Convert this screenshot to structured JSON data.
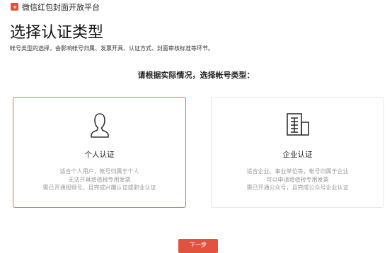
{
  "header": {
    "app_title": "微信红包封面开放平台",
    "logo_icon": "red-envelope-icon"
  },
  "page": {
    "title": "选择认证类型",
    "subtitle": "帐号类型的选择，会影响帐号归属、发票开具、认证方式、封面审核标准等环节。",
    "prompt": "请根据实际情况，选择帐号类型："
  },
  "cards": [
    {
      "id": "personal",
      "icon": "person-icon",
      "title": "个人认证",
      "desc": [
        "适合个人用户，帐号归属于个人",
        "无法开具增值税专用发票",
        "需已开通视频号，且完成兴趣认证或职业认证"
      ],
      "selected": true,
      "accent": "#e06a58"
    },
    {
      "id": "enterprise",
      "icon": "building-icon",
      "title": "企业认证",
      "desc": [
        "适合企业、事业单位等，帐号归属于企业",
        "可以申请增值税专用发票",
        "需已开通公众号，且完成公众号企业认证"
      ],
      "selected": false
    }
  ],
  "footer": {
    "next_label": "下一步"
  },
  "colors": {
    "primary": "#e2533f",
    "selected_border": "#e06a58",
    "muted_text": "#9a9a9a"
  }
}
